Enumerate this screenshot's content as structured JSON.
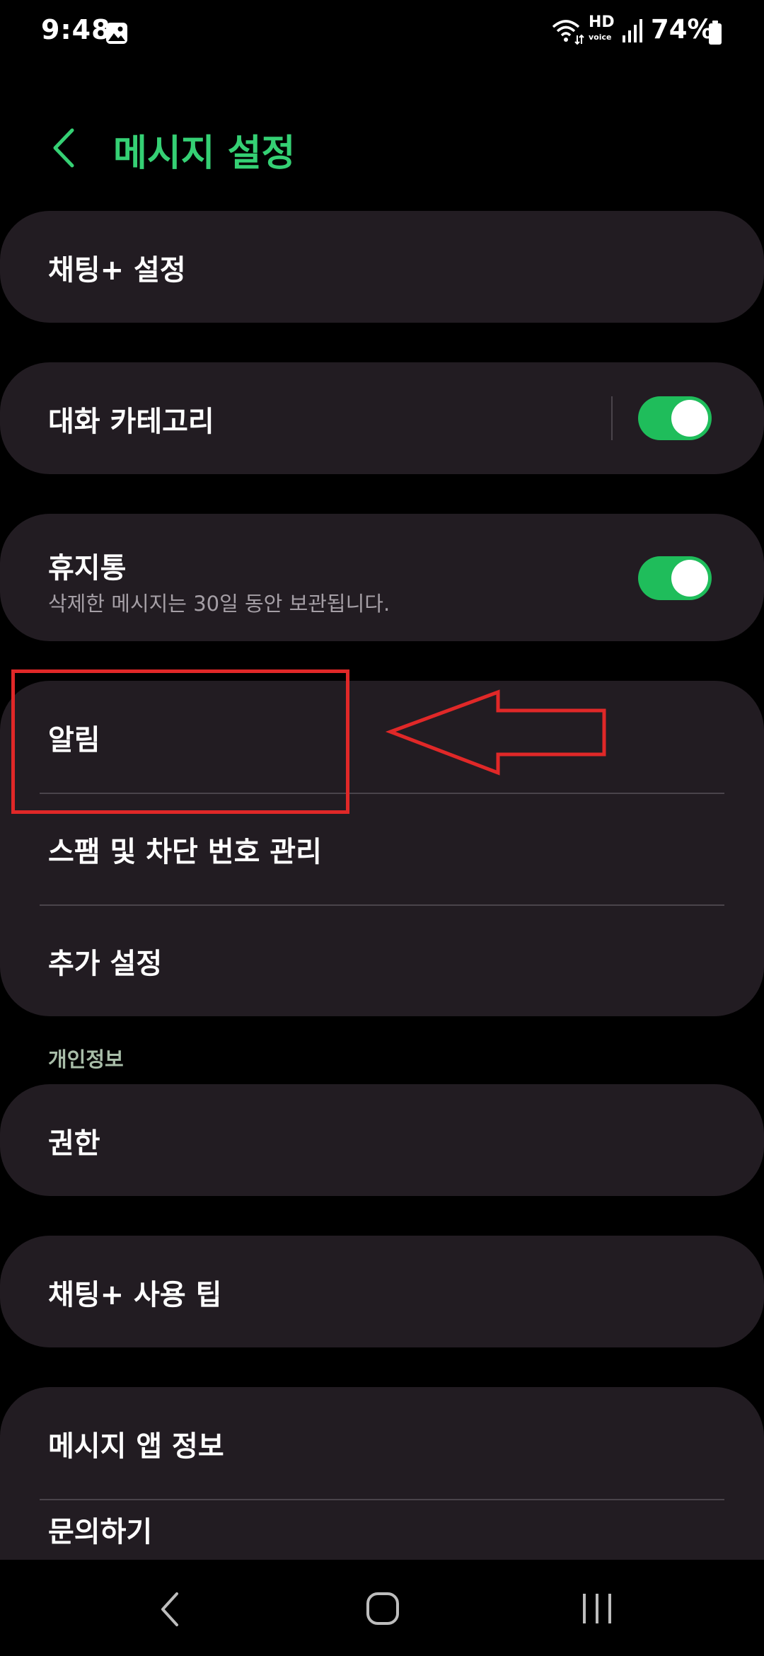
{
  "status_bar": {
    "time": "9:48",
    "hd_label": "HD",
    "voice_label": "voice",
    "battery": "74%",
    "icons": [
      "gallery-icon",
      "wifi-icon",
      "hd-voice-icon",
      "signal-icon",
      "battery-icon"
    ]
  },
  "header": {
    "back_icon": "chevron-left-icon",
    "title": "메시지 설정"
  },
  "settings": {
    "chat_plus": "채팅+ 설정",
    "conversation_categories": {
      "label": "대화 카테고리",
      "enabled": true
    },
    "trash": {
      "label": "휴지통",
      "subtitle": "삭제한 메시지는 30일 동안 보관됩니다.",
      "enabled": true
    },
    "group": [
      {
        "label": "알림"
      },
      {
        "label": "스팸 및 차단 번호 관리"
      },
      {
        "label": "추가 설정"
      }
    ],
    "privacy_header": "개인정보",
    "permissions": "권한",
    "chat_plus_tips": "채팅+ 사용 팁",
    "about": [
      {
        "label": "메시지 앱 정보"
      },
      {
        "label": "문의하기"
      }
    ]
  },
  "colors": {
    "background": "#000000",
    "card": "#221c22",
    "accent": "#35d074",
    "toggle_on": "#1fbd5b",
    "annotation": "#e02828"
  },
  "nav_bar": {
    "icons": [
      "nav-back-icon",
      "nav-home-icon",
      "nav-recents-icon"
    ]
  }
}
